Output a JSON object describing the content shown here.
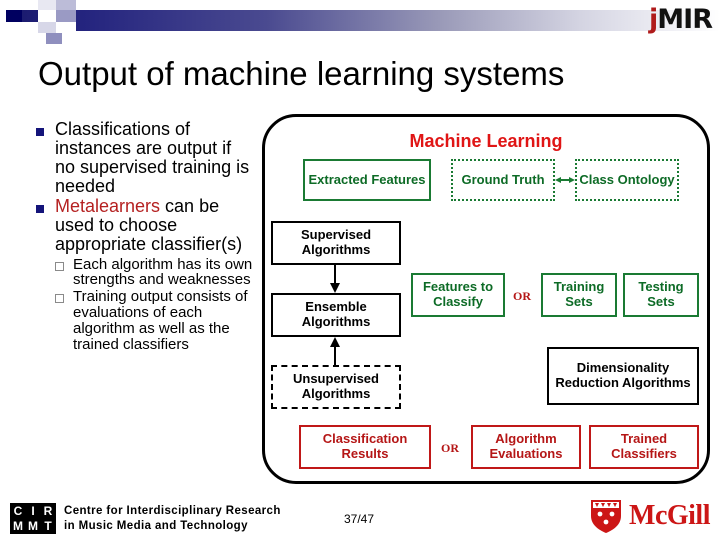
{
  "header": {
    "logo_j": "j",
    "logo_mir": "MIR"
  },
  "slide": {
    "title": "Output of machine learning systems"
  },
  "bullets": [
    {
      "text_before": "",
      "highlight": "",
      "text_after": "Classifications of instances are output if no supervised training is needed",
      "sub": []
    },
    {
      "text_before": "",
      "highlight": "Metalearners",
      "text_after": " can be used to choose appropriate classifier(s)",
      "sub": [
        "Each algorithm has its own strengths and weaknesses",
        "Training output consists of evaluations of each algorithm as well as the trained classifiers"
      ]
    }
  ],
  "diagram": {
    "heading": "Machine Learning",
    "boxes": {
      "extracted_features": "Extracted Features",
      "ground_truth": "Ground Truth",
      "class_ontology": "Class Ontology",
      "supervised": "Supervised Algorithms",
      "ensemble": "Ensemble Algorithms",
      "unsupervised": "Unsupervised Algorithms",
      "features_to_classify": "Features to Classify",
      "training_sets": "Training Sets",
      "testing_sets": "Testing Sets",
      "dimensionality_reduction": "Dimensionality Reduction Algorithms",
      "classification_results": "Classification Results",
      "algorithm_evaluations": "Algorithm Evaluations",
      "trained_classifiers": "Trained Classifiers"
    },
    "or_middle": "OR",
    "or_bottom": "OR",
    "colors": {
      "heading_red": "#e01515",
      "green": "#1a7a33",
      "red": "#c01818",
      "black": "#000000"
    }
  },
  "footer": {
    "cirmmt_letters": [
      "C",
      "I",
      "R",
      "M",
      "M",
      "T"
    ],
    "cirmmt_line1": "Centre for Interdisciplinary Research",
    "cirmmt_line2": "in Music Media and Technology",
    "page_number": "37/47",
    "mcgill_wordmark": "McGill"
  }
}
